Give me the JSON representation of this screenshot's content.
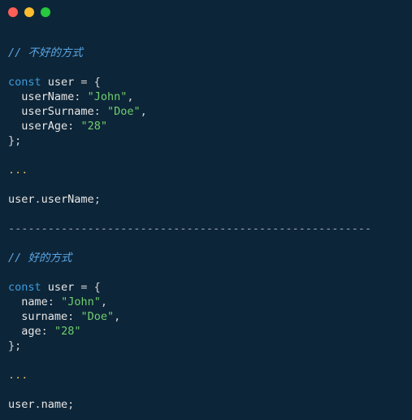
{
  "titlebar": {
    "dots": [
      "red",
      "yellow",
      "green"
    ]
  },
  "code": {
    "bad_comment": "// 不好的方式",
    "good_comment": "// 好的方式",
    "const_kw": "const",
    "user_var": "user",
    "eq_open": " = {",
    "bad_props": {
      "p1_key": "userName",
      "p1_val": "\"John\"",
      "p2_key": "userSurname",
      "p2_val": "\"Doe\"",
      "p3_key": "userAge",
      "p3_val": "\"28\""
    },
    "good_props": {
      "p1_key": "name",
      "p1_val": "\"John\"",
      "p2_key": "surname",
      "p2_val": "\"Doe\"",
      "p3_key": "age",
      "p3_val": "\"28\""
    },
    "close_brace": "};",
    "dots": "...",
    "bad_access_prop": "userName",
    "good_access_prop": "name",
    "colon": ":",
    "comma": ",",
    "dot": ".",
    "semicolon": ";",
    "divider": "-------------------------------------------------------"
  }
}
